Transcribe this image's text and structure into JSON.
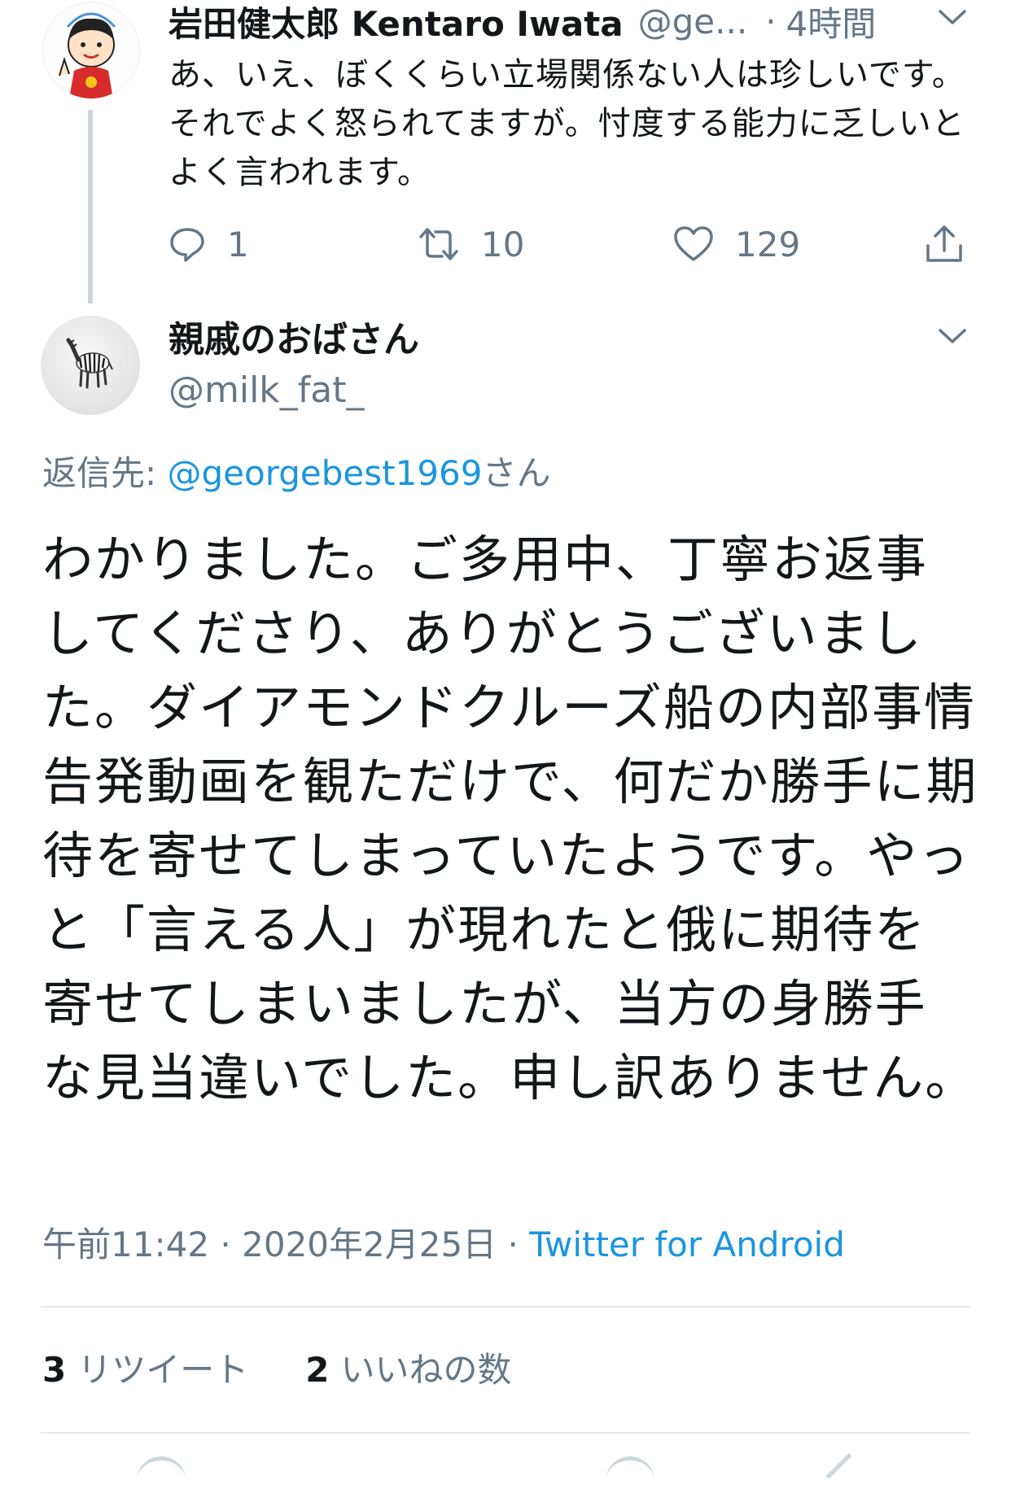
{
  "parent_tweet": {
    "name": "岩田健太郎 Kentaro Iwata",
    "handle": "@ge...",
    "dot": "·",
    "time": "4時間",
    "text": "あ、いえ、ぼくくらい立場関係ない人は珍しいです。それでよく怒られてますが。忖度する能力に乏しいとよく言われます。",
    "replies": "1",
    "retweets": "10",
    "likes": "129"
  },
  "main_tweet": {
    "name": "親戚のおばさん",
    "handle": "@milk_fat_",
    "reply_to_label": "返信先: ",
    "reply_to_mention": "@georgebest1969",
    "reply_to_suffix": "さん",
    "text": "わかりました。ご多用中、丁寧お返事してくださり、ありがとうございました。ダイアモンドクルーズ船の内部事情告発動画を観ただけで、何だか勝手に期待を寄せてしまっていたようです。やっと「言える人」が現れたと俄に期待を寄せてしまいましたが、当方の身勝手な見当違いでした。申し訳ありません。",
    "time": "午前11:42",
    "date": "2020年2月25日",
    "separator": "·",
    "source": "Twitter for Android",
    "retweet_count": "3",
    "retweet_label": "リツイート",
    "like_count": "2",
    "like_label": "いいねの数"
  },
  "colors": {
    "text": "#14171a",
    "secondary": "#657786",
    "link": "#1b95e0",
    "divider": "#e6ecf0",
    "thread_line": "#ccd6dd"
  },
  "icons": {
    "caret": "chevron-down-icon",
    "reply": "reply-icon",
    "retweet": "retweet-icon",
    "like": "heart-icon",
    "share": "share-icon"
  }
}
